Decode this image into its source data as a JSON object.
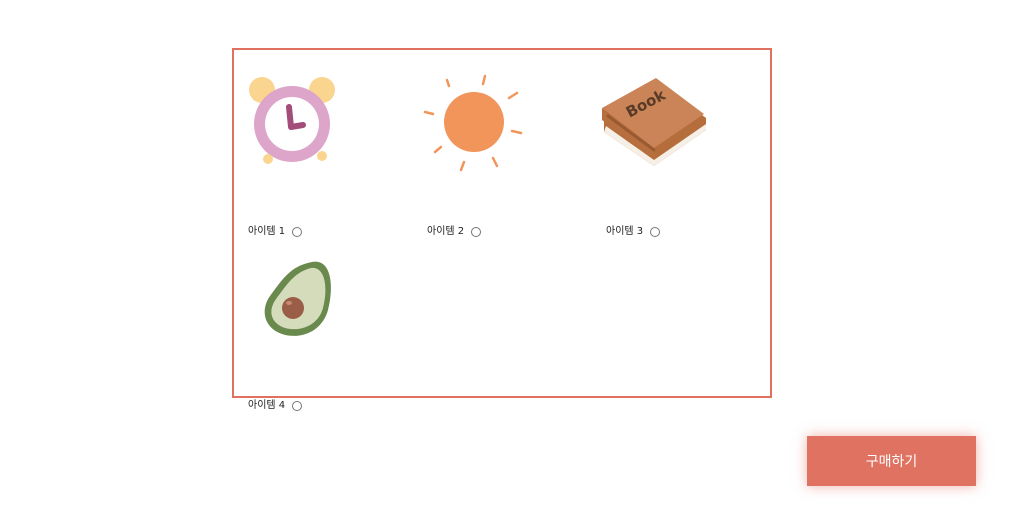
{
  "items": [
    {
      "label": "아이템 1",
      "icon": "alarm-clock-icon"
    },
    {
      "label": "아이템 2",
      "icon": "sun-icon"
    },
    {
      "label": "아이템 3",
      "icon": "book-icon",
      "book_text": "Book"
    },
    {
      "label": "아이템 4",
      "icon": "avocado-icon"
    }
  ],
  "buy_button": {
    "label": "구매하기"
  },
  "colors": {
    "panel_border": "#e07060",
    "button_bg": "#e07262",
    "button_text": "#ffffff"
  }
}
